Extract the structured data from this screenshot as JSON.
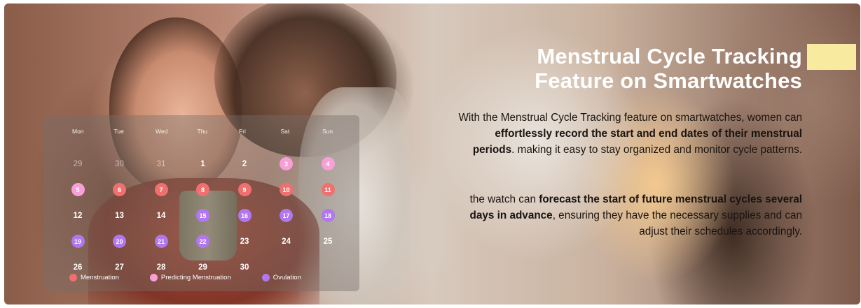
{
  "hero": {
    "title_line1": "Menstrual Cycle Tracking",
    "title_line2": "Feature on Smartwatches",
    "accent_color": "#f8ea9e",
    "paragraph1": {
      "part1": "With the Menstrual Cycle Tracking feature on smartwatches, women can ",
      "bold": "effortlessly record the start and end dates of their menstrual periods",
      "part2": ". making it easy to stay organized and monitor cycle patterns."
    },
    "paragraph2": {
      "part1": "the watch can ",
      "bold": "forecast the start of future menstrual cycles several days in advance",
      "part2": ", ensuring they have the necessary supplies and can adjust their schedules accordingly."
    }
  },
  "calendar": {
    "weekdays": [
      "Mon",
      "Tue",
      "Wed",
      "Thu",
      "Fri",
      "Sat",
      "Sun"
    ],
    "days": [
      {
        "label": "29",
        "type": "muted"
      },
      {
        "label": "30",
        "type": "muted"
      },
      {
        "label": "31",
        "type": "muted"
      },
      {
        "label": "1",
        "type": "plain"
      },
      {
        "label": "2",
        "type": "plain"
      },
      {
        "label": "3",
        "type": "predicting"
      },
      {
        "label": "4",
        "type": "predicting"
      },
      {
        "label": "5",
        "type": "predicting"
      },
      {
        "label": "6",
        "type": "menstruation"
      },
      {
        "label": "7",
        "type": "menstruation"
      },
      {
        "label": "8",
        "type": "menstruation"
      },
      {
        "label": "9",
        "type": "menstruation"
      },
      {
        "label": "10",
        "type": "menstruation"
      },
      {
        "label": "11",
        "type": "menstruation"
      },
      {
        "label": "12",
        "type": "plain"
      },
      {
        "label": "13",
        "type": "plain"
      },
      {
        "label": "14",
        "type": "plain"
      },
      {
        "label": "15",
        "type": "ovulation"
      },
      {
        "label": "16",
        "type": "ovulation"
      },
      {
        "label": "17",
        "type": "ovulation"
      },
      {
        "label": "18",
        "type": "ovulation"
      },
      {
        "label": "19",
        "type": "ovulation"
      },
      {
        "label": "20",
        "type": "ovulation"
      },
      {
        "label": "21",
        "type": "ovulation"
      },
      {
        "label": "22",
        "type": "ovulation"
      },
      {
        "label": "23",
        "type": "plain"
      },
      {
        "label": "24",
        "type": "plain"
      },
      {
        "label": "25",
        "type": "plain"
      },
      {
        "label": "26",
        "type": "plain"
      },
      {
        "label": "27",
        "type": "plain"
      },
      {
        "label": "28",
        "type": "plain"
      },
      {
        "label": "29",
        "type": "plain"
      },
      {
        "label": "30",
        "type": "plain"
      }
    ],
    "legend": [
      {
        "label": "Menstruation",
        "color": "#f0706f"
      },
      {
        "label": "Predicting Menstruation",
        "color": "#f7a0d8"
      },
      {
        "label": "Ovulation",
        "color": "#b077ee"
      }
    ]
  }
}
